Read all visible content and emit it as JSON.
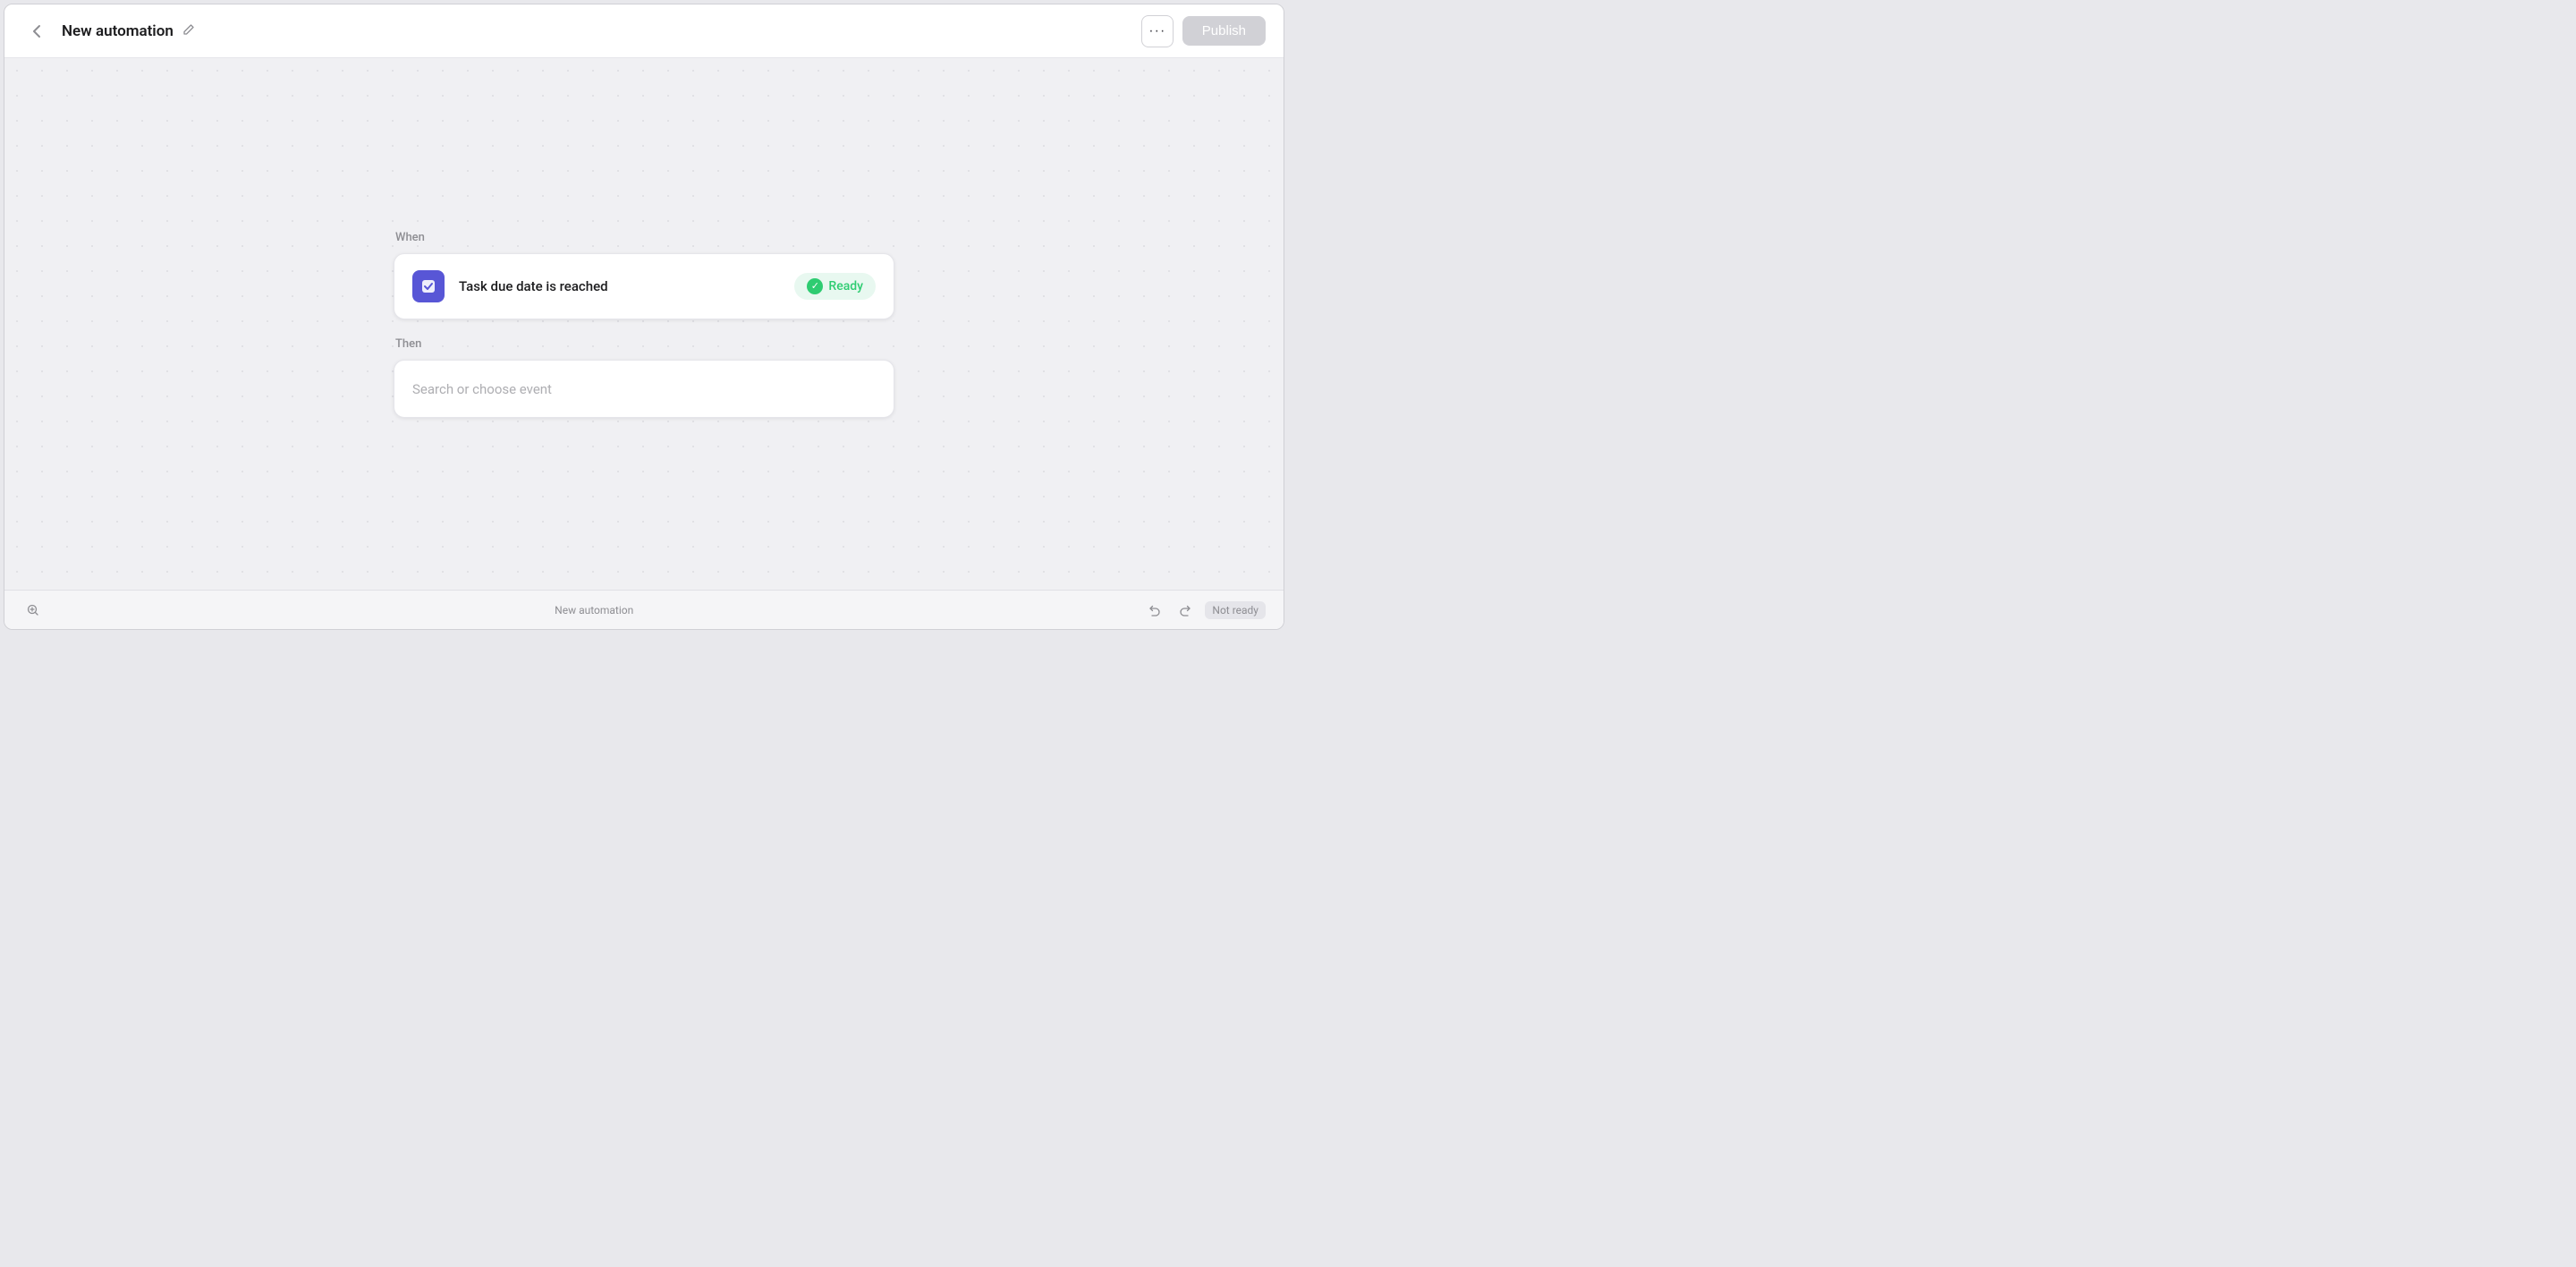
{
  "header": {
    "title": "New automation",
    "back_label": "←",
    "edit_icon": "✏",
    "more_label": "···",
    "publish_label": "Publish"
  },
  "canvas": {
    "when_label": "When",
    "then_label": "Then",
    "trigger": {
      "label": "Task due date is reached",
      "status": "Ready"
    },
    "action": {
      "placeholder": "Search or choose event"
    }
  },
  "bottom_bar": {
    "left_icon": "↩",
    "center_text": "New automation",
    "undo_icon": "↩",
    "redo_icon": "↪",
    "status": "Not ready"
  },
  "colors": {
    "publish_disabled": "#d1d1d6",
    "trigger_icon_bg": "#5856d6",
    "ready_bg": "#e8f8f0",
    "ready_text": "#2ecc71"
  }
}
